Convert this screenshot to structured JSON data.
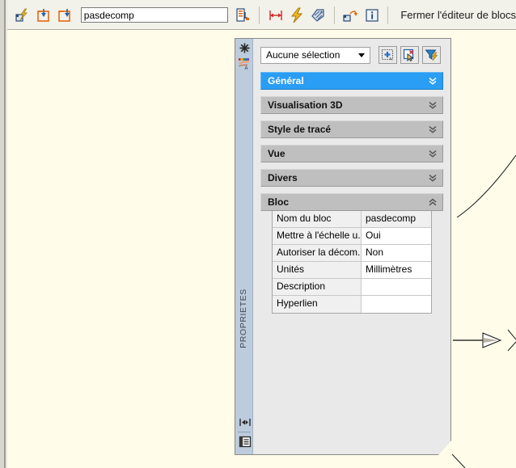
{
  "app": {
    "canvas_background": "#fffdea",
    "accent_selected": "#2a9df4"
  },
  "toolbar": {
    "buttons": [
      {
        "name": "edit-block-definition",
        "icon": "block-edit-lightning-icon"
      },
      {
        "name": "save-block-definition",
        "icon": "save-block-down-arrow-icon"
      },
      {
        "name": "save-block-as",
        "icon": "save-block-as-arrow-icon"
      }
    ],
    "blockname_value": "pasdecomp",
    "blockname_placeholder": "",
    "buttons_right": [
      {
        "name": "authoring-palettes",
        "icon": "authoring-palette-icon"
      },
      {
        "name": "parameter",
        "icon": "parameter-distance-icon"
      },
      {
        "name": "action",
        "icon": "action-lightning-icon"
      },
      {
        "name": "define-attribute",
        "icon": "attribute-tag-icon"
      },
      {
        "name": "update-parameter-visibility",
        "icon": "update-parameter-icon"
      },
      {
        "name": "block-information",
        "icon": "info-icon"
      }
    ],
    "close_editor_label": "Fermer l'éditeur de blocs"
  },
  "palette": {
    "title_vertical": "PROPRIETES",
    "strip_icons": [
      {
        "name": "close-palette-icon",
        "glyph": "asterisk"
      },
      {
        "name": "quick-properties-icon",
        "glyph": "color-hand"
      }
    ],
    "strip_bottom_icons": [
      {
        "name": "auto-hide-icon",
        "glyph": "collapse-arrows"
      },
      {
        "name": "palette-menu-icon",
        "glyph": "properties-menu"
      }
    ],
    "selection": {
      "combo_value": "Aucune sélection",
      "buttons": [
        {
          "name": "toggle-pickadd-button",
          "icon": "pickadd-icon"
        },
        {
          "name": "select-objects-button",
          "icon": "select-objects-icon"
        },
        {
          "name": "quick-select-button",
          "icon": "quick-select-funnel-icon"
        }
      ]
    },
    "categories": [
      {
        "label": "Général",
        "selected": true,
        "expanded": false
      },
      {
        "label": "Visualisation 3D",
        "selected": false,
        "expanded": false
      },
      {
        "label": "Style de tracé",
        "selected": false,
        "expanded": false
      },
      {
        "label": "Vue",
        "selected": false,
        "expanded": false
      },
      {
        "label": "Divers",
        "selected": false,
        "expanded": false
      },
      {
        "label": "Bloc",
        "selected": false,
        "expanded": true
      }
    ],
    "block_properties": [
      {
        "name": "Nom du bloc",
        "value": "pasdecomp",
        "readonly": true
      },
      {
        "name": "Mettre à l'échelle u...",
        "value": "Oui",
        "readonly": false
      },
      {
        "name": "Autoriser la décom...",
        "value": "Non",
        "readonly": false
      },
      {
        "name": "Unités",
        "value": "Millimètres",
        "readonly": false
      },
      {
        "name": "Description",
        "value": "",
        "readonly": false
      },
      {
        "name": "Hyperlien",
        "value": "",
        "readonly": false
      }
    ]
  },
  "drawing": {
    "entities": [
      {
        "name": "arc-curve",
        "type": "arc"
      },
      {
        "name": "leader-arrow",
        "type": "arrow"
      },
      {
        "name": "partial-cross-mark",
        "type": "polyline"
      },
      {
        "name": "panel-corner-line",
        "type": "line"
      }
    ]
  }
}
